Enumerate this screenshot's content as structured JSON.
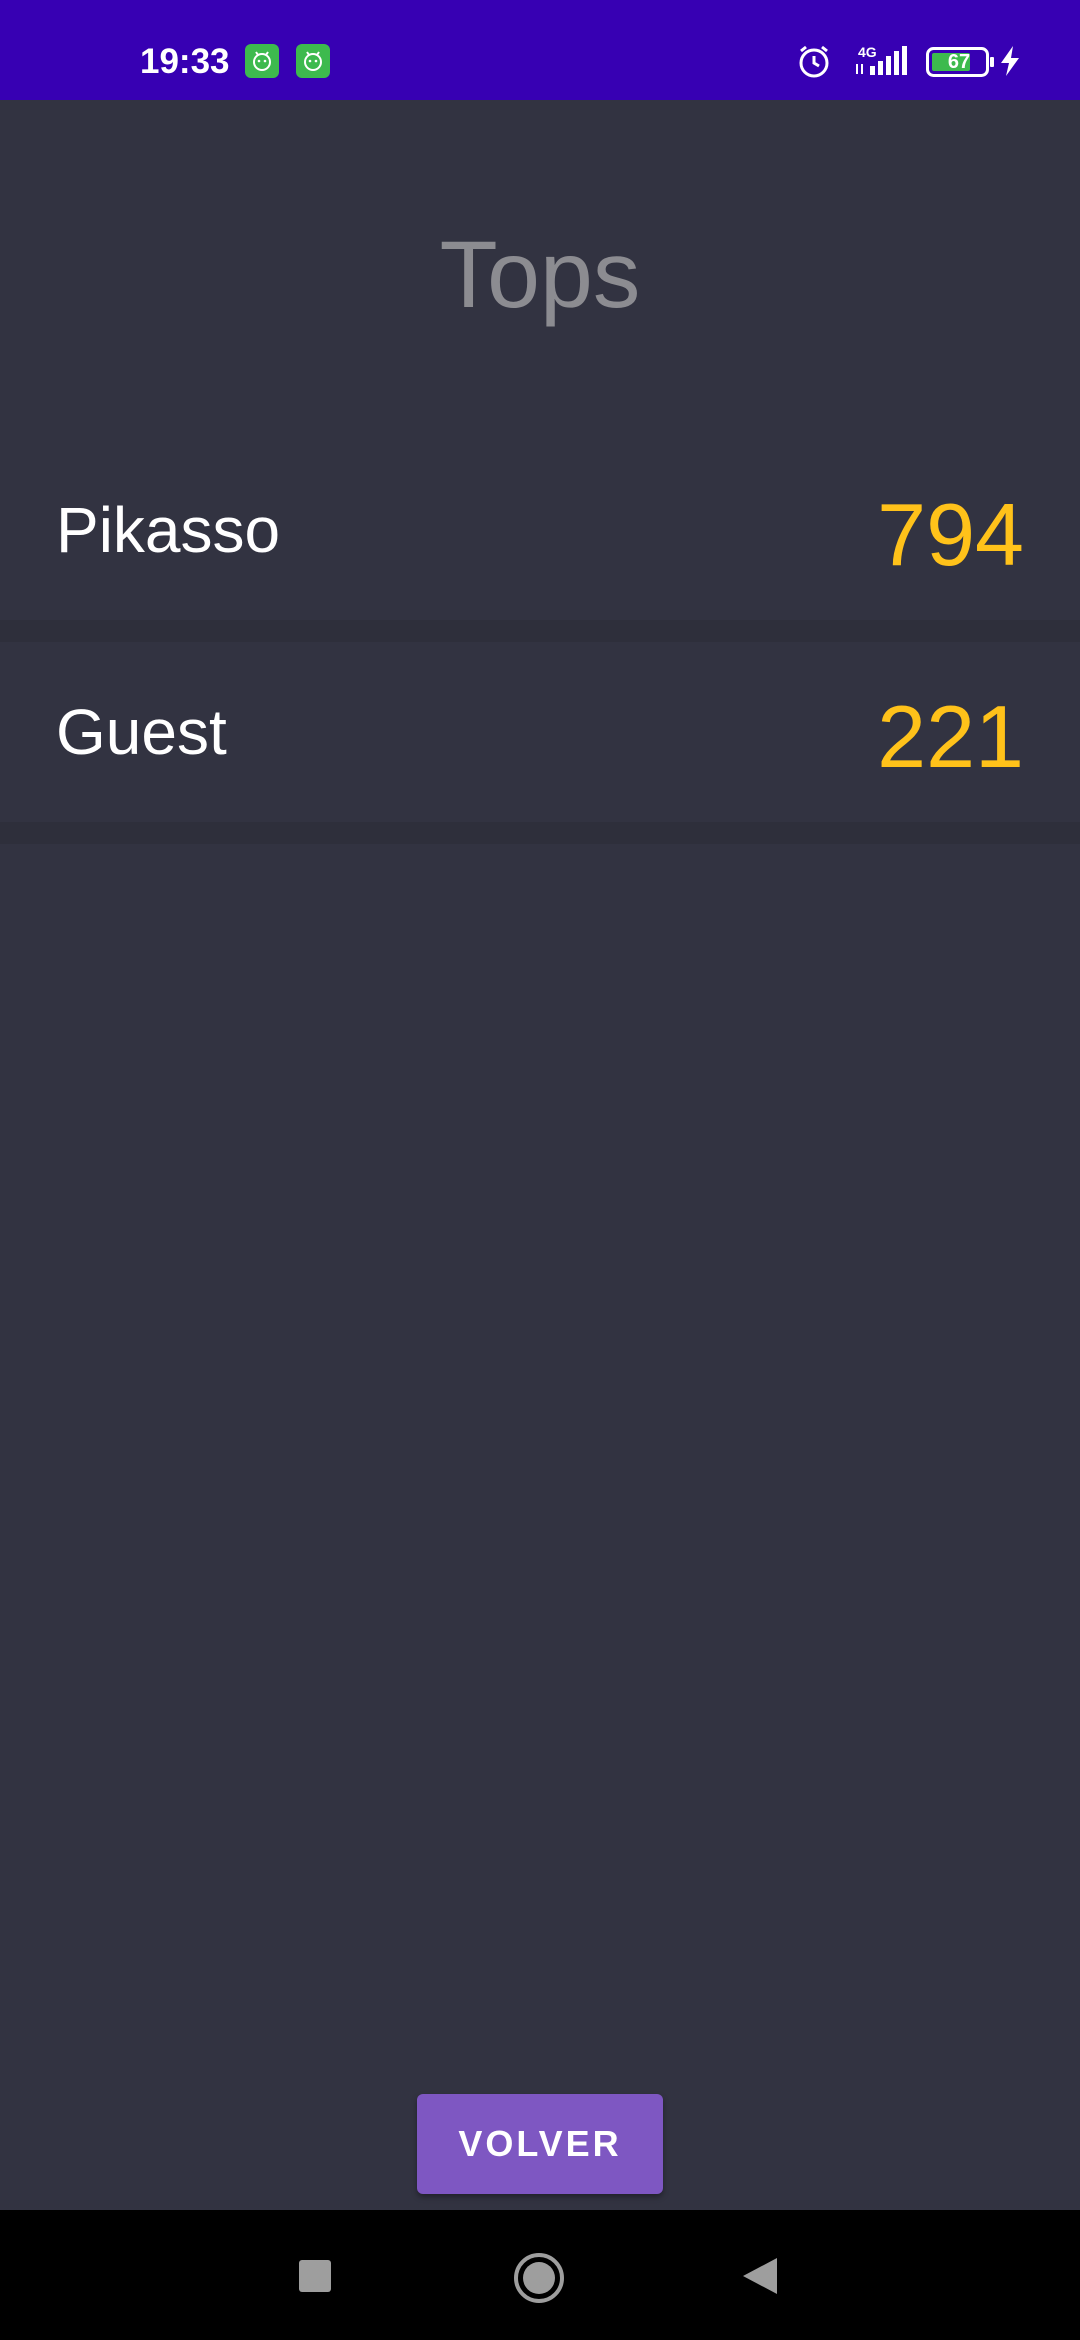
{
  "status_bar": {
    "time": "19:33",
    "network": "4G",
    "battery_level": "67",
    "icons": [
      "app-notification-icon",
      "app-notification-icon",
      "alarm-icon",
      "signal-icon",
      "battery-icon",
      "charging-icon"
    ],
    "background_color": "#3700b3"
  },
  "main": {
    "title": "Tops",
    "rows": [
      {
        "name": "Pikasso",
        "score": "794"
      },
      {
        "name": "Guest",
        "score": "221"
      }
    ],
    "score_color": "#ffc21a"
  },
  "footer": {
    "back_label": "VOLVER",
    "button_color": "#7e57c2"
  },
  "nav_bar": {
    "icons": [
      "recents-icon",
      "home-icon",
      "back-icon"
    ]
  }
}
